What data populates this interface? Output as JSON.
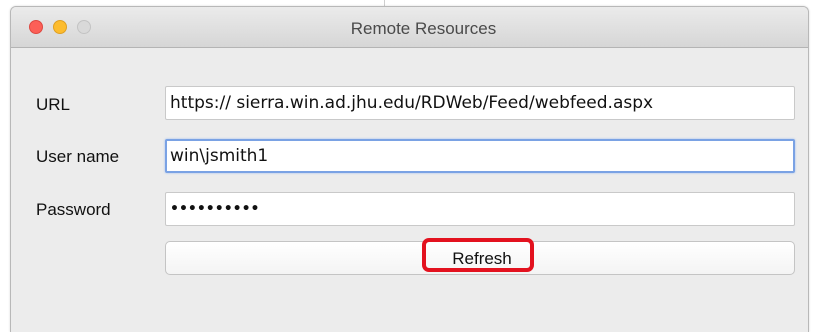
{
  "window": {
    "title": "Remote Resources"
  },
  "form": {
    "url_label": "URL",
    "url_value": "https:// sierra.win.ad.jhu.edu/RDWeb/Feed/webfeed.aspx",
    "username_label": "User name",
    "username_value": "win\\jsmith1",
    "password_label": "Password",
    "password_value": "••••••••••",
    "refresh_label": "Refresh"
  },
  "colors": {
    "highlight": "#e3121f",
    "focus_ring": "#7aa2e4",
    "close": "#fc5f57",
    "minimize": "#fdbc2e",
    "zoom_disabled": "#d9d9d9"
  },
  "icons": {
    "close": "traffic-light-close",
    "minimize": "traffic-light-minimize",
    "zoom": "traffic-light-zoom"
  }
}
